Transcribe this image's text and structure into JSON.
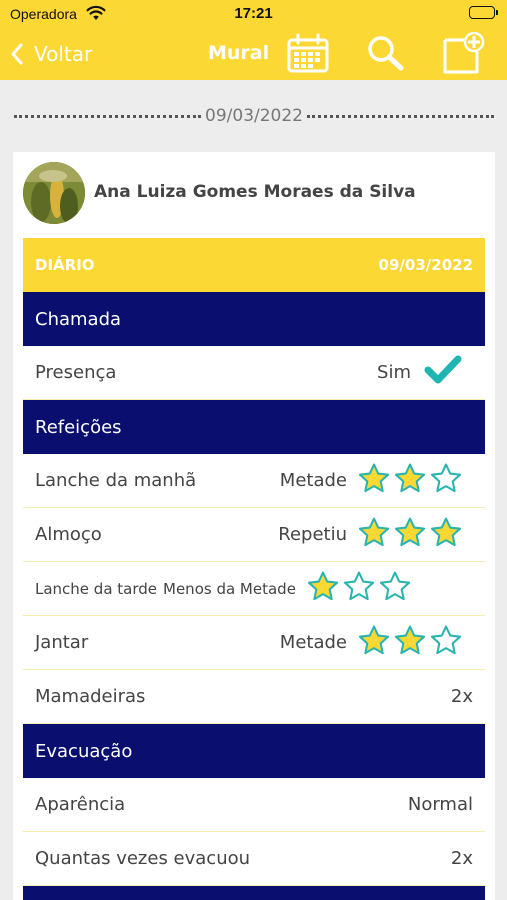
{
  "status_bar": {
    "carrier": "Operadora",
    "time": "17:21"
  },
  "navbar": {
    "back_label": "Voltar",
    "title": "Mural",
    "icons": [
      "calendar-icon",
      "search-icon",
      "new-post-icon"
    ]
  },
  "date_divider": "09/03/2022",
  "card": {
    "name": "Ana Luiza Gomes Moraes da Silva",
    "diary_label": "DIÁRIO",
    "diary_date": "09/03/2022",
    "sections": {
      "chamada": {
        "title": "Chamada",
        "presenca": {
          "label": "Presença",
          "value": "Sim"
        }
      },
      "refeicoes": {
        "title": "Refeições",
        "items": [
          {
            "label": "Lanche da manhã",
            "value": "Metade",
            "rating": 2,
            "max": 3
          },
          {
            "label": "Almoço",
            "value": "Repetiu",
            "rating": 3,
            "max": 3
          },
          {
            "label": "Lanche da tarde",
            "value": "Menos da Metade",
            "rating": 1,
            "max": 3
          },
          {
            "label": "Jantar",
            "value": "Metade",
            "rating": 2,
            "max": 3
          }
        ],
        "mamadeiras": {
          "label": "Mamadeiras",
          "value": "2x"
        }
      },
      "evacuacao": {
        "title": "Evacuação",
        "aparencia": {
          "label": "Aparência",
          "value": "Normal"
        },
        "vezes": {
          "label": "Quantas vezes evacuou",
          "value": "2x"
        }
      }
    }
  },
  "colors": {
    "accent": "#fcd835",
    "section": "#0a0e6e",
    "check": "#1fb5b0",
    "star_fill": "#fcd835",
    "star_outline": "#2ab4b0"
  }
}
